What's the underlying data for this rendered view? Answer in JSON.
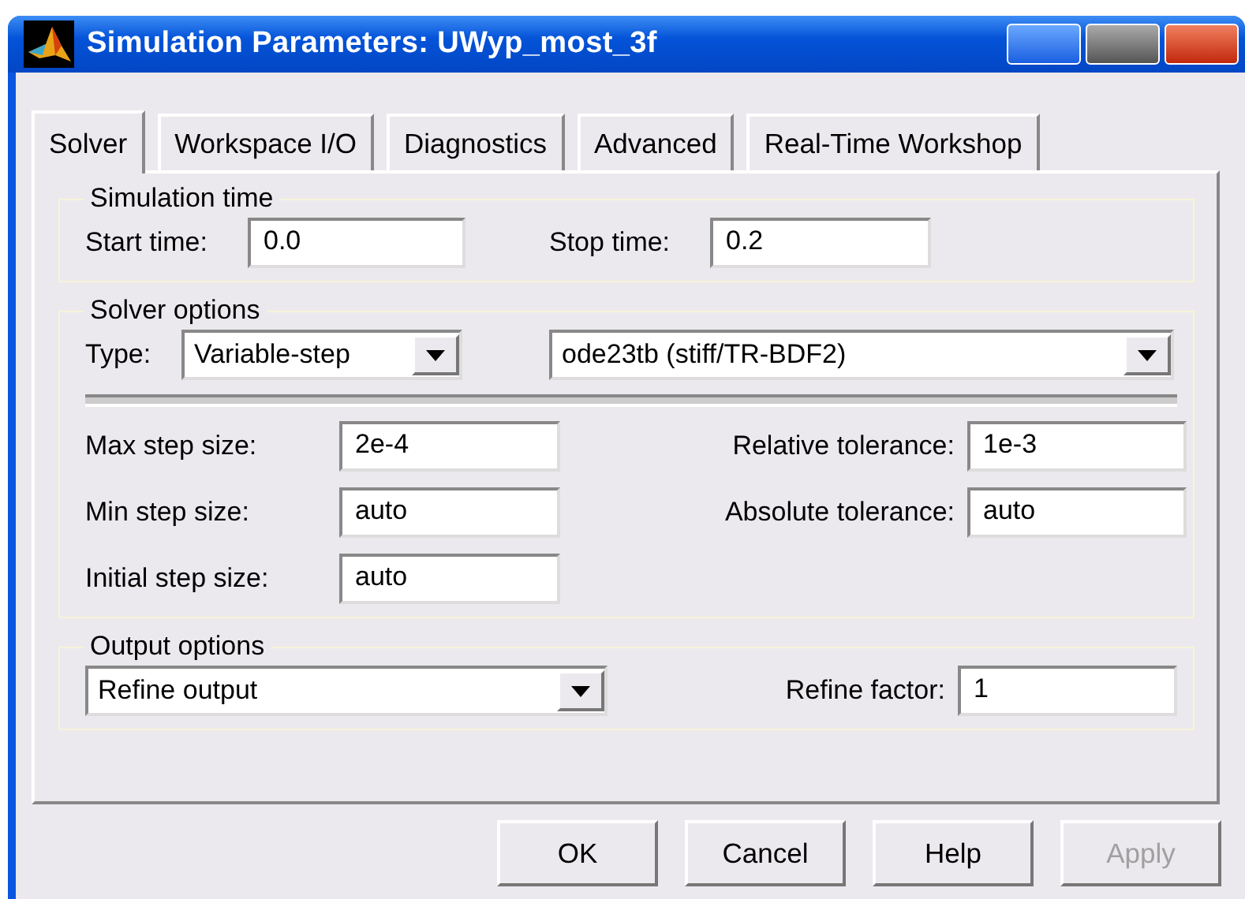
{
  "window": {
    "title": "Simulation Parameters: UWyp_most_3f"
  },
  "tabs": [
    {
      "label": "Solver",
      "selected": true
    },
    {
      "label": "Workspace I/O",
      "selected": false
    },
    {
      "label": "Diagnostics",
      "selected": false
    },
    {
      "label": "Advanced",
      "selected": false
    },
    {
      "label": "Real-Time Workshop",
      "selected": false
    }
  ],
  "simulation_time": {
    "title": "Simulation time",
    "start_label": "Start time:",
    "start_value": "0.0",
    "stop_label": "Stop time:",
    "stop_value": "0.2"
  },
  "solver_options": {
    "title": "Solver options",
    "type_label": "Type:",
    "type_value": "Variable-step",
    "solver_value": "ode23tb (stiff/TR-BDF2)",
    "left_fields": [
      {
        "label": "Max step size:",
        "value": "2e-4"
      },
      {
        "label": "Min step size:",
        "value": "auto"
      },
      {
        "label": "Initial step size:",
        "value": "auto"
      }
    ],
    "right_fields": [
      {
        "label": "Relative tolerance:",
        "value": "1e-3"
      },
      {
        "label": "Absolute tolerance:",
        "value": "auto"
      }
    ]
  },
  "output_options": {
    "title": "Output options",
    "mode_value": "Refine output",
    "factor_label": "Refine factor:",
    "factor_value": "1"
  },
  "buttons": [
    {
      "label": "OK",
      "disabled": false
    },
    {
      "label": "Cancel",
      "disabled": false
    },
    {
      "label": "Help",
      "disabled": false
    },
    {
      "label": "Apply",
      "disabled": true
    }
  ]
}
